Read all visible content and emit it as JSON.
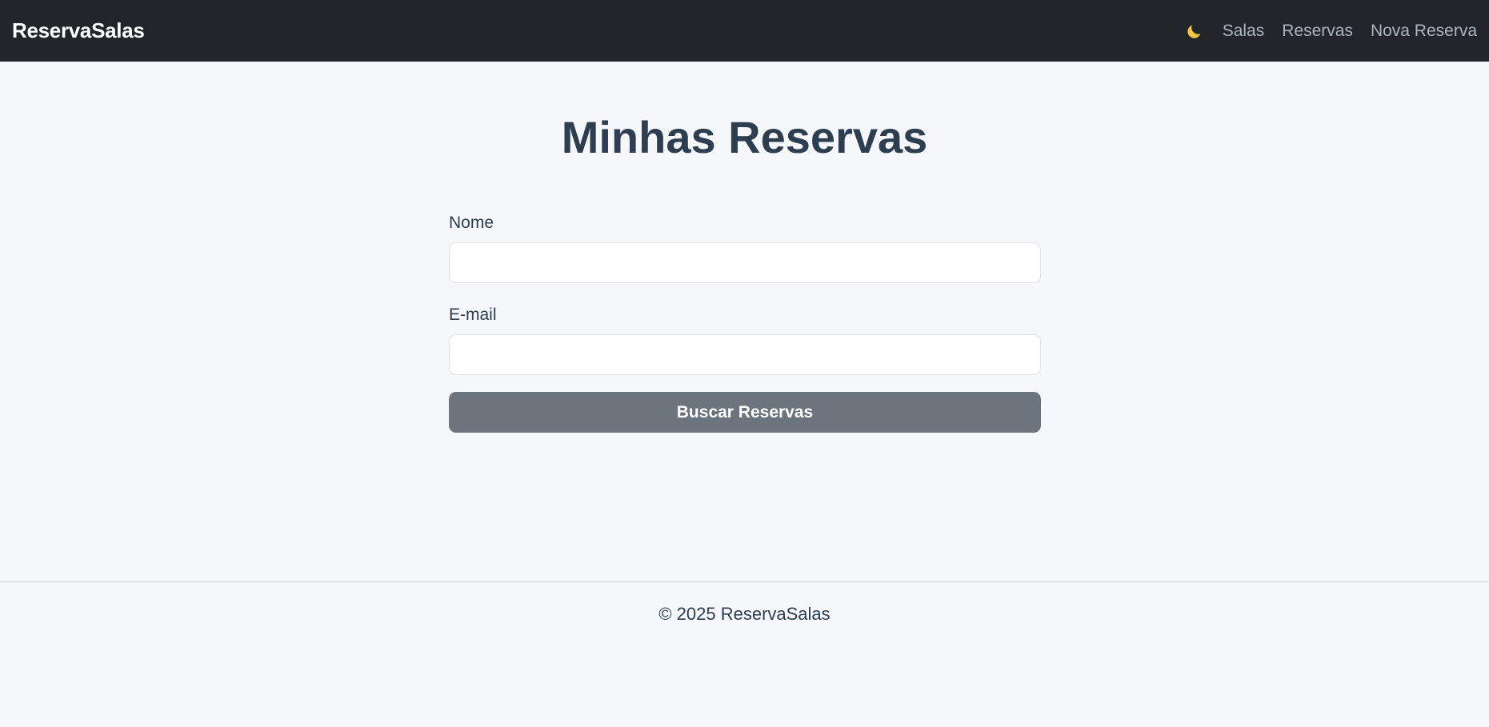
{
  "navbar": {
    "brand": "ReservaSalas",
    "theme_toggle_icon": "moon-icon",
    "links": [
      {
        "label": "Salas"
      },
      {
        "label": "Reservas"
      },
      {
        "label": "Nova Reserva"
      }
    ]
  },
  "main": {
    "title": "Minhas Reservas",
    "form": {
      "name_label": "Nome",
      "name_value": "",
      "email_label": "E-mail",
      "email_value": "",
      "submit_label": "Buscar Reservas"
    }
  },
  "footer": {
    "text": "© 2025 ReservaSalas"
  },
  "colors": {
    "navbar_bg": "#212529",
    "page_bg": "#f5f7fa",
    "button_bg": "#6c757d",
    "moon": "#f5c542",
    "text": "#2c3e50"
  }
}
